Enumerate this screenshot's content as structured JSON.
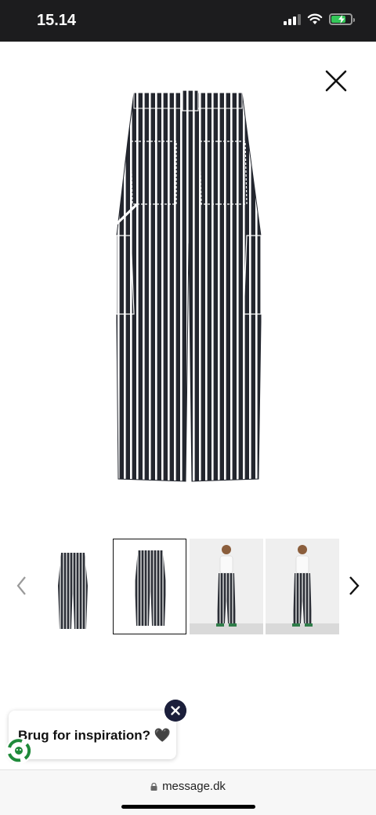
{
  "status_bar": {
    "time": "15.14",
    "battery_level": 0.75,
    "battery_color": "#34c759"
  },
  "product": {
    "pattern_colors": {
      "dark": "#23262e",
      "light": "#ffffff"
    }
  },
  "gallery": {
    "thumbnails": [
      "front-flat",
      "back-flat",
      "model-front",
      "model-back"
    ],
    "selected_index": 1
  },
  "chat": {
    "prompt": "Brug for inspiration? 🖤"
  },
  "browser": {
    "url": "message.dk"
  }
}
